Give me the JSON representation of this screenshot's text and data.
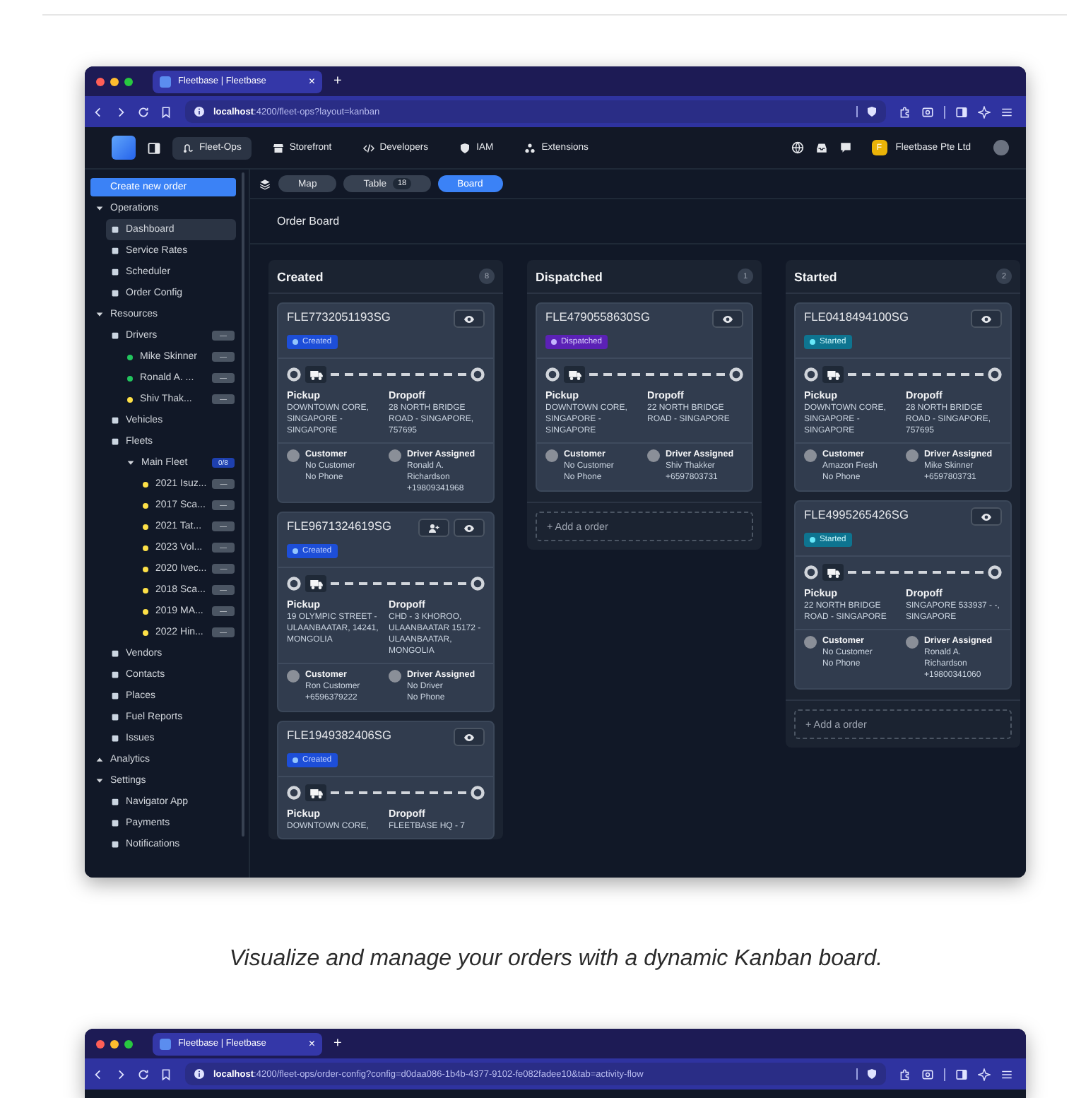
{
  "figures": [
    {
      "browser": {
        "tab_title": "Fleetbase | Fleetbase",
        "tab_close": "×",
        "new_tab": "+",
        "url": "**localhost**:4200/fleet-ops?layout=kanban"
      },
      "app": {
        "nav": [
          {
            "label": "Fleet-Ops",
            "selected": true
          },
          {
            "label": "Storefront",
            "selected": false
          },
          {
            "label": "Developers",
            "selected": false
          },
          {
            "label": "IAM",
            "selected": false
          },
          {
            "label": "Extensions",
            "selected": false
          }
        ],
        "org": {
          "initial": "F",
          "name": "Fleetbase Pte Ltd"
        },
        "sidebar": {
          "create_button": "Create new order",
          "sections": [
            {
              "label": "Operations",
              "expanded": true,
              "children": [
                {
                  "label": "Dashboard",
                  "selected": true
                },
                {
                  "label": "Service Rates",
                  "selected": false
                },
                {
                  "label": "Scheduler",
                  "selected": false
                },
                {
                  "label": "Order Config",
                  "selected": false
                }
              ]
            },
            {
              "label": "Resources",
              "expanded": true,
              "children": [
                {
                  "label": "Drivers",
                  "selected": false,
                  "badge": "—",
                  "children": [
                    {
                      "label": "Mike Skinner",
                      "selected": false,
                      "color": "#22c55e",
                      "badge": "—"
                    },
                    {
                      "label": "Ronald A. ...",
                      "selected": false,
                      "color": "#22c55e",
                      "badge": "—"
                    },
                    {
                      "label": "Shiv Thak...",
                      "selected": false,
                      "color": "#fde047",
                      "badge": "—"
                    }
                  ]
                },
                {
                  "label": "Vehicles",
                  "selected": false
                },
                {
                  "label": "Fleets",
                  "selected": false,
                  "children": [
                    {
                      "label": "Main Fleet",
                      "selected": false,
                      "expanded": true,
                      "badge": "0/8",
                      "children": [
                        {
                          "label": "2021 Isuz...",
                          "selected": false,
                          "color": "#fde047",
                          "badge": "—"
                        },
                        {
                          "label": "2017 Sca...",
                          "selected": false,
                          "color": "#fde047",
                          "badge": "—"
                        },
                        {
                          "label": "2021 Tat...",
                          "selected": false,
                          "color": "#fde047",
                          "badge": "—"
                        },
                        {
                          "label": "2023 Vol...",
                          "selected": false,
                          "color": "#fde047",
                          "badge": "—"
                        },
                        {
                          "label": "2020 Ivec...",
                          "selected": false,
                          "color": "#fde047",
                          "badge": "—"
                        },
                        {
                          "label": "2018 Sca...",
                          "selected": false,
                          "color": "#fde047",
                          "badge": "—"
                        },
                        {
                          "label": "2019 MA...",
                          "selected": false,
                          "color": "#fde047",
                          "badge": "—"
                        },
                        {
                          "label": "2022 Hin...",
                          "selected": false,
                          "color": "#fde047",
                          "badge": "—"
                        }
                      ]
                    }
                  ]
                },
                {
                  "label": "Vendors",
                  "selected": false
                },
                {
                  "label": "Contacts",
                  "selected": false
                },
                {
                  "label": "Places",
                  "selected": false
                },
                {
                  "label": "Fuel Reports",
                  "selected": false
                },
                {
                  "label": "Issues",
                  "selected": false
                }
              ]
            },
            {
              "label": "Analytics",
              "expanded": false
            },
            {
              "label": "Settings",
              "expanded": true,
              "children": [
                {
                  "label": "Navigator App",
                  "selected": false
                },
                {
                  "label": "Payments",
                  "selected": false
                },
                {
                  "label": "Notifications",
                  "selected": false
                }
              ]
            }
          ]
        },
        "views": [
          {
            "label": "Map",
            "selected": false
          },
          {
            "label": "Table",
            "count": "18",
            "selected": false
          },
          {
            "label": "Board",
            "selected": true
          }
        ],
        "page_title": "Order Board",
        "columns": [
          {
            "title": "Created",
            "count": "8",
            "cards": [
              {
                "id": "FLE7732051193SG",
                "status": {
                  "label": "Created",
                  "kind": "created"
                },
                "assign_button": false,
                "pickup": {
                  "label": "Pickup",
                  "address": "DOWNTOWN CORE, SINGAPORE - SINGAPORE"
                },
                "dropoff": {
                  "label": "Dropoff",
                  "address": "28 NORTH BRIDGE ROAD - SINGAPORE, 757695"
                },
                "customer": {
                  "label": "Customer",
                  "lines": [
                    "No Customer",
                    "No Phone"
                  ]
                },
                "driver": {
                  "label": "Driver Assigned",
                  "lines": [
                    "Ronald A. Richardson",
                    "+19809341968"
                  ]
                }
              },
              {
                "id": "FLE9671324619SG",
                "status": {
                  "label": "Created",
                  "kind": "created"
                },
                "assign_button": true,
                "pickup": {
                  "label": "Pickup",
                  "address": "19 OLYMPIC STREET - ULAANBAATAR, 14241, MONGOLIA"
                },
                "dropoff": {
                  "label": "Dropoff",
                  "address": "CHD - 3 KHOROO, ULAANBAATAR 15172 - ULAANBAATAR, MONGOLIA"
                },
                "customer": {
                  "label": "Customer",
                  "lines": [
                    "Ron Customer",
                    "+6596379222"
                  ]
                },
                "driver": {
                  "label": "Driver Assigned",
                  "lines": [
                    "No Driver",
                    "No Phone"
                  ]
                }
              },
              {
                "id": "FLE1949382406SG",
                "status": {
                  "label": "Created",
                  "kind": "created"
                },
                "assign_button": false,
                "pickup": {
                  "label": "Pickup",
                  "address": "DOWNTOWN CORE,"
                },
                "dropoff": {
                  "label": "Dropoff",
                  "address": "FLEETBASE HQ - 7"
                }
              }
            ]
          },
          {
            "title": "Dispatched",
            "count": "1",
            "add_label": "+ Add a order",
            "cards": [
              {
                "id": "FLE4790558630SG",
                "status": {
                  "label": "Dispatched",
                  "kind": "dispatched"
                },
                "assign_button": false,
                "pickup": {
                  "label": "Pickup",
                  "address": "DOWNTOWN CORE, SINGAPORE - SINGAPORE"
                },
                "dropoff": {
                  "label": "Dropoff",
                  "address": "22 NORTH BRIDGE ROAD - SINGAPORE"
                },
                "customer": {
                  "label": "Customer",
                  "lines": [
                    "No Customer",
                    "No Phone"
                  ]
                },
                "driver": {
                  "label": "Driver Assigned",
                  "lines": [
                    "Shiv Thakker",
                    "+6597803731"
                  ]
                }
              }
            ]
          },
          {
            "title": "Started",
            "count": "2",
            "add_label": "+ Add a order",
            "cards": [
              {
                "id": "FLE0418494100SG",
                "status": {
                  "label": "Started",
                  "kind": "started"
                },
                "assign_button": false,
                "pickup": {
                  "label": "Pickup",
                  "address": "DOWNTOWN CORE, SINGAPORE - SINGAPORE"
                },
                "dropoff": {
                  "label": "Dropoff",
                  "address": "28 NORTH BRIDGE ROAD - SINGAPORE, 757695"
                },
                "customer": {
                  "label": "Customer",
                  "lines": [
                    "Amazon Fresh",
                    "No Phone"
                  ]
                },
                "driver": {
                  "label": "Driver Assigned",
                  "lines": [
                    "Mike Skinner",
                    "+6597803731"
                  ]
                }
              },
              {
                "id": "FLE4995265426SG",
                "status": {
                  "label": "Started",
                  "kind": "started"
                },
                "assign_button": false,
                "pickup": {
                  "label": "Pickup",
                  "address": "22 NORTH BRIDGE ROAD - SINGAPORE"
                },
                "dropoff": {
                  "label": "Dropoff",
                  "address": "SINGAPORE 533937 - -, SINGAPORE"
                },
                "customer": {
                  "label": "Customer",
                  "lines": [
                    "No Customer",
                    "No Phone"
                  ]
                },
                "driver": {
                  "label": "Driver Assigned",
                  "lines": [
                    "Ronald A. Richardson",
                    "+19800341060"
                  ]
                }
              }
            ]
          }
        ]
      },
      "caption": "Visualize and manage your orders with a dynamic Kanban board."
    },
    {
      "browser": {
        "tab_title": "Fleetbase | Fleetbase",
        "tab_close": "×",
        "new_tab": "+",
        "url": "**localhost**:4200/fleet-ops/order-config?config=d0daa086-1b4b-4377-9102-fe082fadee10&tab=activity-flow"
      }
    }
  ]
}
